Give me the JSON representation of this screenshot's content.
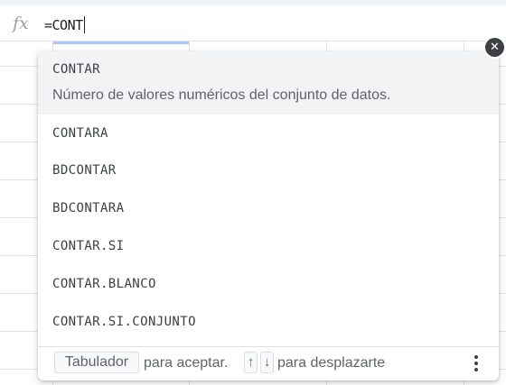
{
  "formula_bar": {
    "fx_label": "fx",
    "formula": "=CONT"
  },
  "autocomplete": {
    "selected": {
      "name": "CONTAR",
      "description": "Número de valores numéricos del conjunto de datos."
    },
    "items": [
      {
        "name": "CONTARA"
      },
      {
        "name": "BDCONTAR"
      },
      {
        "name": "BDCONTARA"
      },
      {
        "name": "CONTAR.SI"
      },
      {
        "name": "CONTAR.BLANCO"
      },
      {
        "name": "CONTAR.SI.CONJUNTO"
      }
    ],
    "footer": {
      "tab_key": "Tabulador",
      "accept_text": "para aceptar.",
      "up_key": "↑",
      "down_key": "↓",
      "scroll_text": "para desplazarte"
    }
  },
  "close_label": "✕",
  "colors": {
    "accent": "#a8c7fa",
    "selected_row": "#f1f3f4",
    "close_bg": "#3c4043"
  }
}
